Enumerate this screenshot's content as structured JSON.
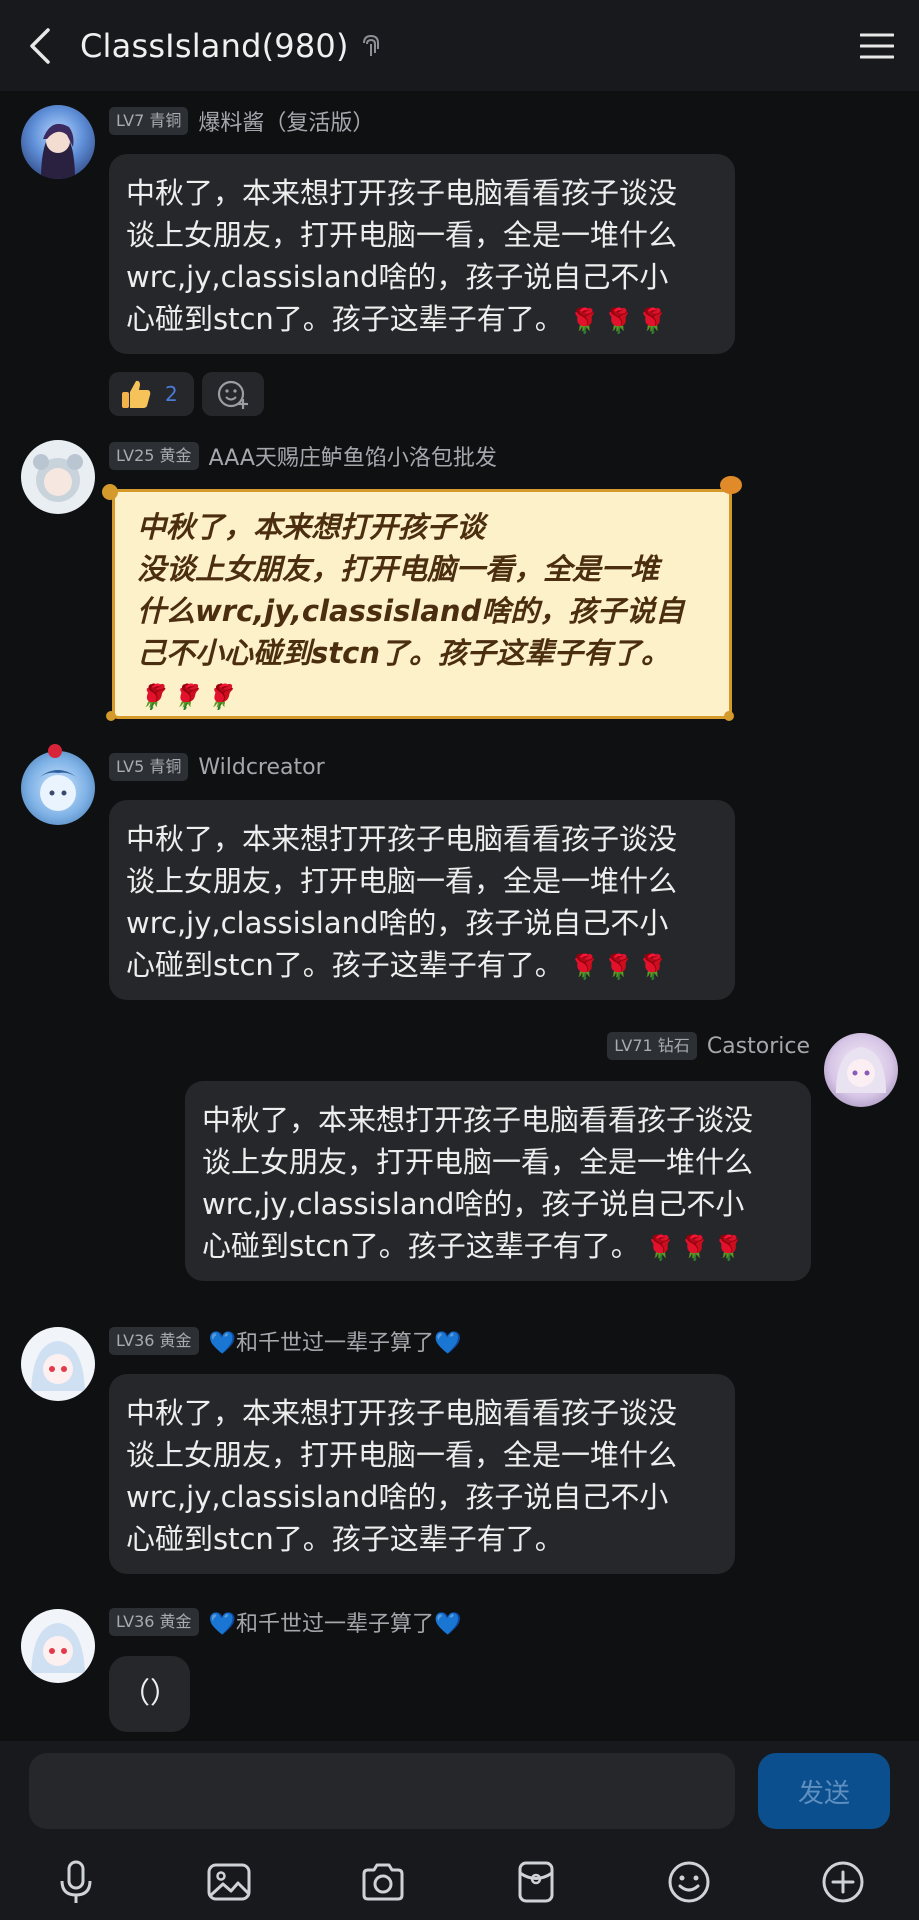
{
  "header": {
    "title": "ClassIsland(980)",
    "back_icon": "chevron-left-icon",
    "menu_icon": "hamburger-menu-icon"
  },
  "messages": [
    {
      "level": "LV7 青铜",
      "name": "爆料酱（复活版）",
      "text": "中秋了，本来想打开孩子电脑看看孩子谈没\n谈上女朋友，打开电脑一看，全是一堆什么\nwrc,jy,classisland啥的，孩子说自己不小\n心碰到stcn了。孩子这辈子有了。",
      "roses": "🌹🌹🌹",
      "reactions": {
        "thumbs_up_count": "2"
      }
    },
    {
      "level": "LV25 黄金",
      "name": "AAA天赐庄鲈鱼馅小洛包批发",
      "text": "中秋了，本来想打开孩子谈\n没谈上女朋友，打开电脑一看，全是一堆\n什么wrc,jy,classisland啥的，孩子说自\n己不小心碰到stcn了。孩子这辈子有了。",
      "roses": "🌹🌹🌹"
    },
    {
      "level": "LV5 青铜",
      "name": "Wildcreator",
      "text": "中秋了，本来想打开孩子电脑看看孩子谈没\n谈上女朋友，打开电脑一看，全是一堆什么\nwrc,jy,classisland啥的，孩子说自己不小\n心碰到stcn了。孩子这辈子有了。",
      "roses": "🌹🌹🌹"
    },
    {
      "level": "LV71 钻石",
      "name": "Castorice",
      "text": "中秋了，本来想打开孩子电脑看看孩子谈没\n谈上女朋友，打开电脑一看，全是一堆什么\nwrc,jy,classisland啥的，孩子说自己不小\n心碰到stcn了。孩子这辈子有了。",
      "roses": "🌹🌹🌹"
    },
    {
      "level": "LV36 黄金",
      "name": "💙和千世过一辈子算了💙",
      "text": "中秋了，本来想打开孩子电脑看看孩子谈没\n谈上女朋友，打开电脑一看，全是一堆什么\nwrc,jy,classisland啥的，孩子说自己不小\n心碰到stcn了。孩子这辈子有了。"
    },
    {
      "level": "LV36 黄金",
      "name": "💙和千世过一辈子算了💙",
      "text": "（）"
    }
  ],
  "input": {
    "placeholder": "",
    "send_label": "发送"
  },
  "toolbar": [
    "microphone-icon",
    "image-icon",
    "camera-icon",
    "red-packet-icon",
    "emoji-icon",
    "plus-icon"
  ],
  "colors": {
    "background": "#0f1012",
    "header": "#17191c",
    "bubble": "#25272b",
    "send_button": "#0b4f8f",
    "fancy_bubble": "#fdf1c9",
    "fancy_border": "#d49a2c"
  }
}
